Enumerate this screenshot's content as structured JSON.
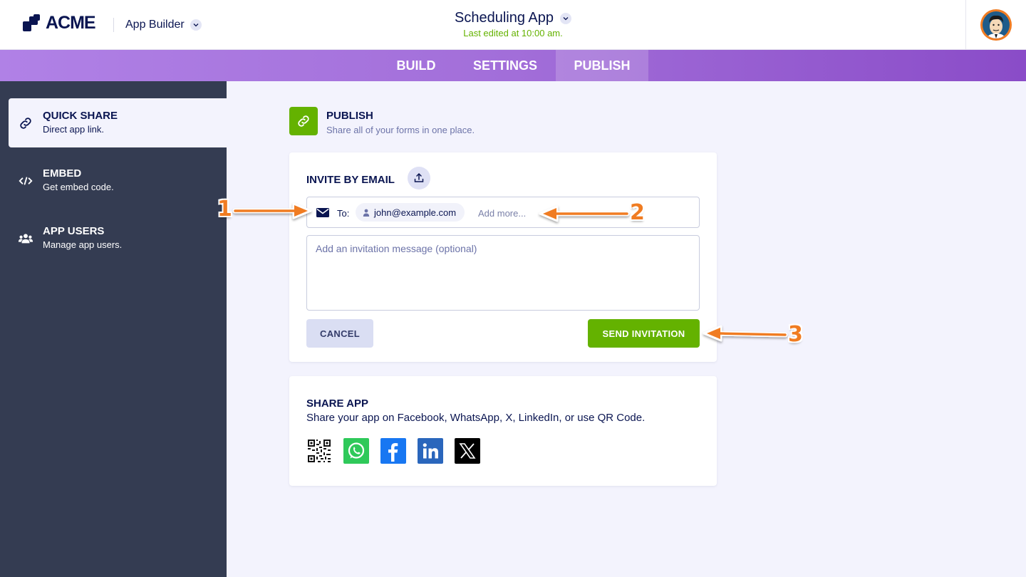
{
  "header": {
    "logo_text": "ACME",
    "builder_label": "App Builder",
    "app_title": "Scheduling App",
    "last_edited": "Last edited at 10:00 am."
  },
  "nav": {
    "tabs": [
      {
        "label": "BUILD",
        "active": false
      },
      {
        "label": "SETTINGS",
        "active": false
      },
      {
        "label": "PUBLISH",
        "active": true
      }
    ]
  },
  "sidebar": {
    "items": [
      {
        "title": "QUICK SHARE",
        "description": "Direct app link.",
        "icon": "link-icon",
        "active": true
      },
      {
        "title": "EMBED",
        "description": "Get embed code.",
        "icon": "code-icon",
        "active": false
      },
      {
        "title": "APP USERS",
        "description": "Manage app users.",
        "icon": "users-icon",
        "active": false
      }
    ]
  },
  "publish": {
    "title": "PUBLISH",
    "subtitle": "Share all of your forms in one place."
  },
  "invite": {
    "title": "INVITE BY EMAIL",
    "to_label": "To:",
    "recipient": "john@example.com",
    "add_more_placeholder": "Add more...",
    "message_placeholder": "Add an invitation message (optional)",
    "cancel_label": "CANCEL",
    "send_label": "SEND INVITATION"
  },
  "share": {
    "title": "SHARE APP",
    "subtitle": "Share your app on Facebook, WhatsApp, X, LinkedIn, or use QR Code.",
    "icons": [
      "qr-code-icon",
      "whatsapp-icon",
      "facebook-icon",
      "linkedin-icon",
      "x-icon"
    ]
  },
  "annotations": [
    "1",
    "2",
    "3"
  ],
  "colors": {
    "accent_green": "#64b200",
    "nav_purple": "#a26ed9",
    "sidebar_bg": "#343c52",
    "annotation_orange": "#f07c22"
  }
}
